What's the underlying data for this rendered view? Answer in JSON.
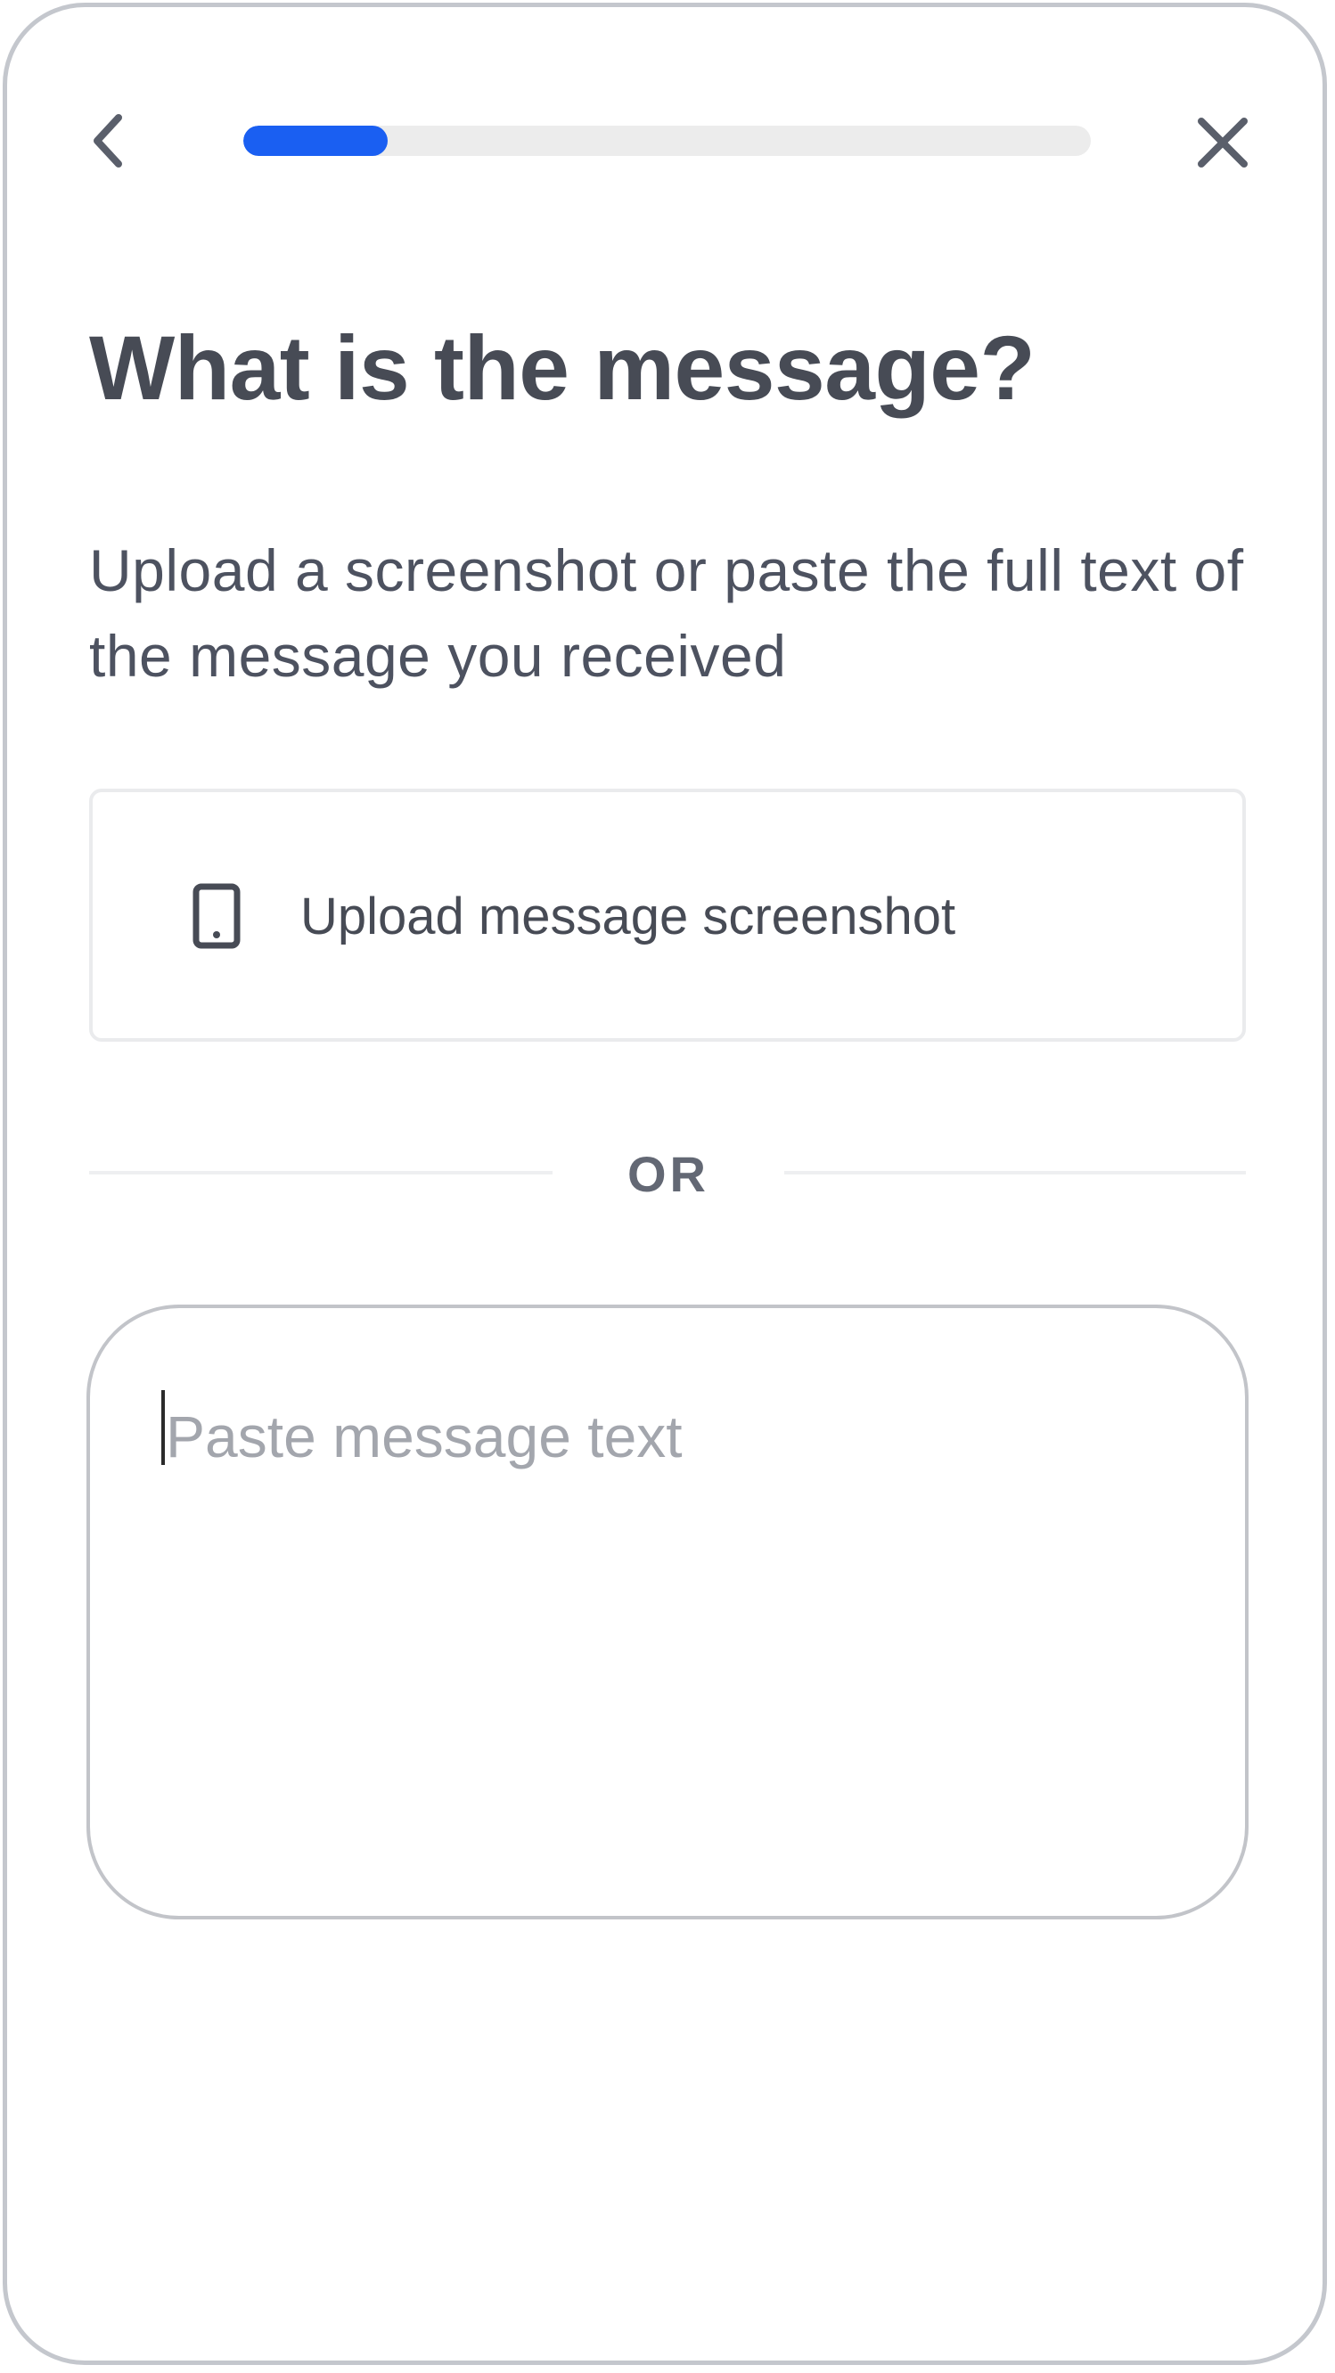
{
  "header": {
    "back_icon": "chevron-left-icon",
    "close_icon": "close-icon",
    "progress_fraction": 0.17,
    "progress_color": "#1a5ff2",
    "track_color": "#ececec"
  },
  "title": "What is the message?",
  "subtitle": "Upload a screenshot or paste the full text of the message you received",
  "upload": {
    "icon": "phone-icon",
    "label": "Upload message screenshot"
  },
  "divider": {
    "label": "OR"
  },
  "message_input": {
    "placeholder": "Paste message text",
    "value": ""
  },
  "colors": {
    "text_primary": "#474b55",
    "accent": "#1a5ff2",
    "border": "#c2c4c9"
  }
}
